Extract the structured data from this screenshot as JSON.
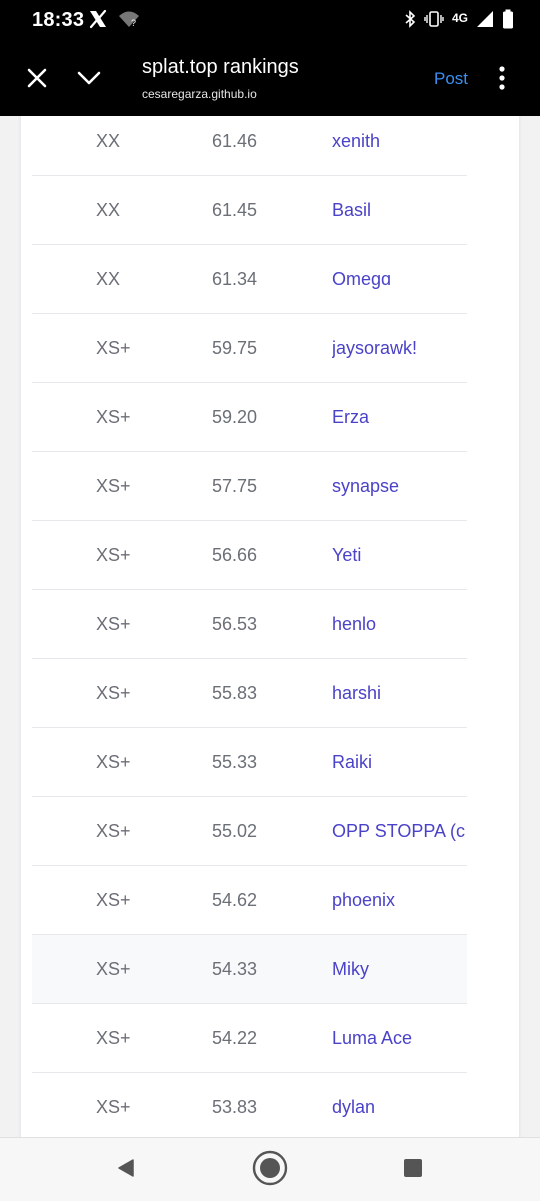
{
  "status_bar": {
    "time": "18:33",
    "network_label": "4G",
    "icons": [
      "x-logo-icon",
      "wifi-unknown-icon",
      "bluetooth-icon",
      "vibrate-icon",
      "signal-icon",
      "battery-icon"
    ]
  },
  "toolbar": {
    "title": "splat.top rankings",
    "url": "cesaregarza.github.io",
    "post_label": "Post",
    "accent_color": "#3b8ff2",
    "icons": [
      "close-icon",
      "chevron-down-icon",
      "more-vertical-icon"
    ]
  },
  "rankings": [
    {
      "tier": "XX",
      "score": "61.46",
      "name": "xenith"
    },
    {
      "tier": "XX",
      "score": "61.45",
      "name": "Basil"
    },
    {
      "tier": "XX",
      "score": "61.34",
      "name": "Omegɑ"
    },
    {
      "tier": "XS+",
      "score": "59.75",
      "name": "jaysorawk!"
    },
    {
      "tier": "XS+",
      "score": "59.20",
      "name": "Erza"
    },
    {
      "tier": "XS+",
      "score": "57.75",
      "name": "synapse"
    },
    {
      "tier": "XS+",
      "score": "56.66",
      "name": "Yeti"
    },
    {
      "tier": "XS+",
      "score": "56.53",
      "name": "henlo"
    },
    {
      "tier": "XS+",
      "score": "55.83",
      "name": "harshi"
    },
    {
      "tier": "XS+",
      "score": "55.33",
      "name": "Raiki"
    },
    {
      "tier": "XS+",
      "score": "55.02",
      "name": "OPP STOPPA (c"
    },
    {
      "tier": "XS+",
      "score": "54.62",
      "name": "phoenix"
    },
    {
      "tier": "XS+",
      "score": "54.33",
      "name": "Miky",
      "highlight": true
    },
    {
      "tier": "XS+",
      "score": "54.22",
      "name": "Luma Ace"
    },
    {
      "tier": "XS+",
      "score": "53.83",
      "name": "dylan"
    }
  ],
  "colors": {
    "name_link": "#4a42c8",
    "muted_text": "#6b6f76",
    "highlight_row": "#f8f9fb"
  },
  "nav_bar": {
    "icons": [
      "back-icon",
      "home-icon",
      "recents-icon"
    ]
  }
}
